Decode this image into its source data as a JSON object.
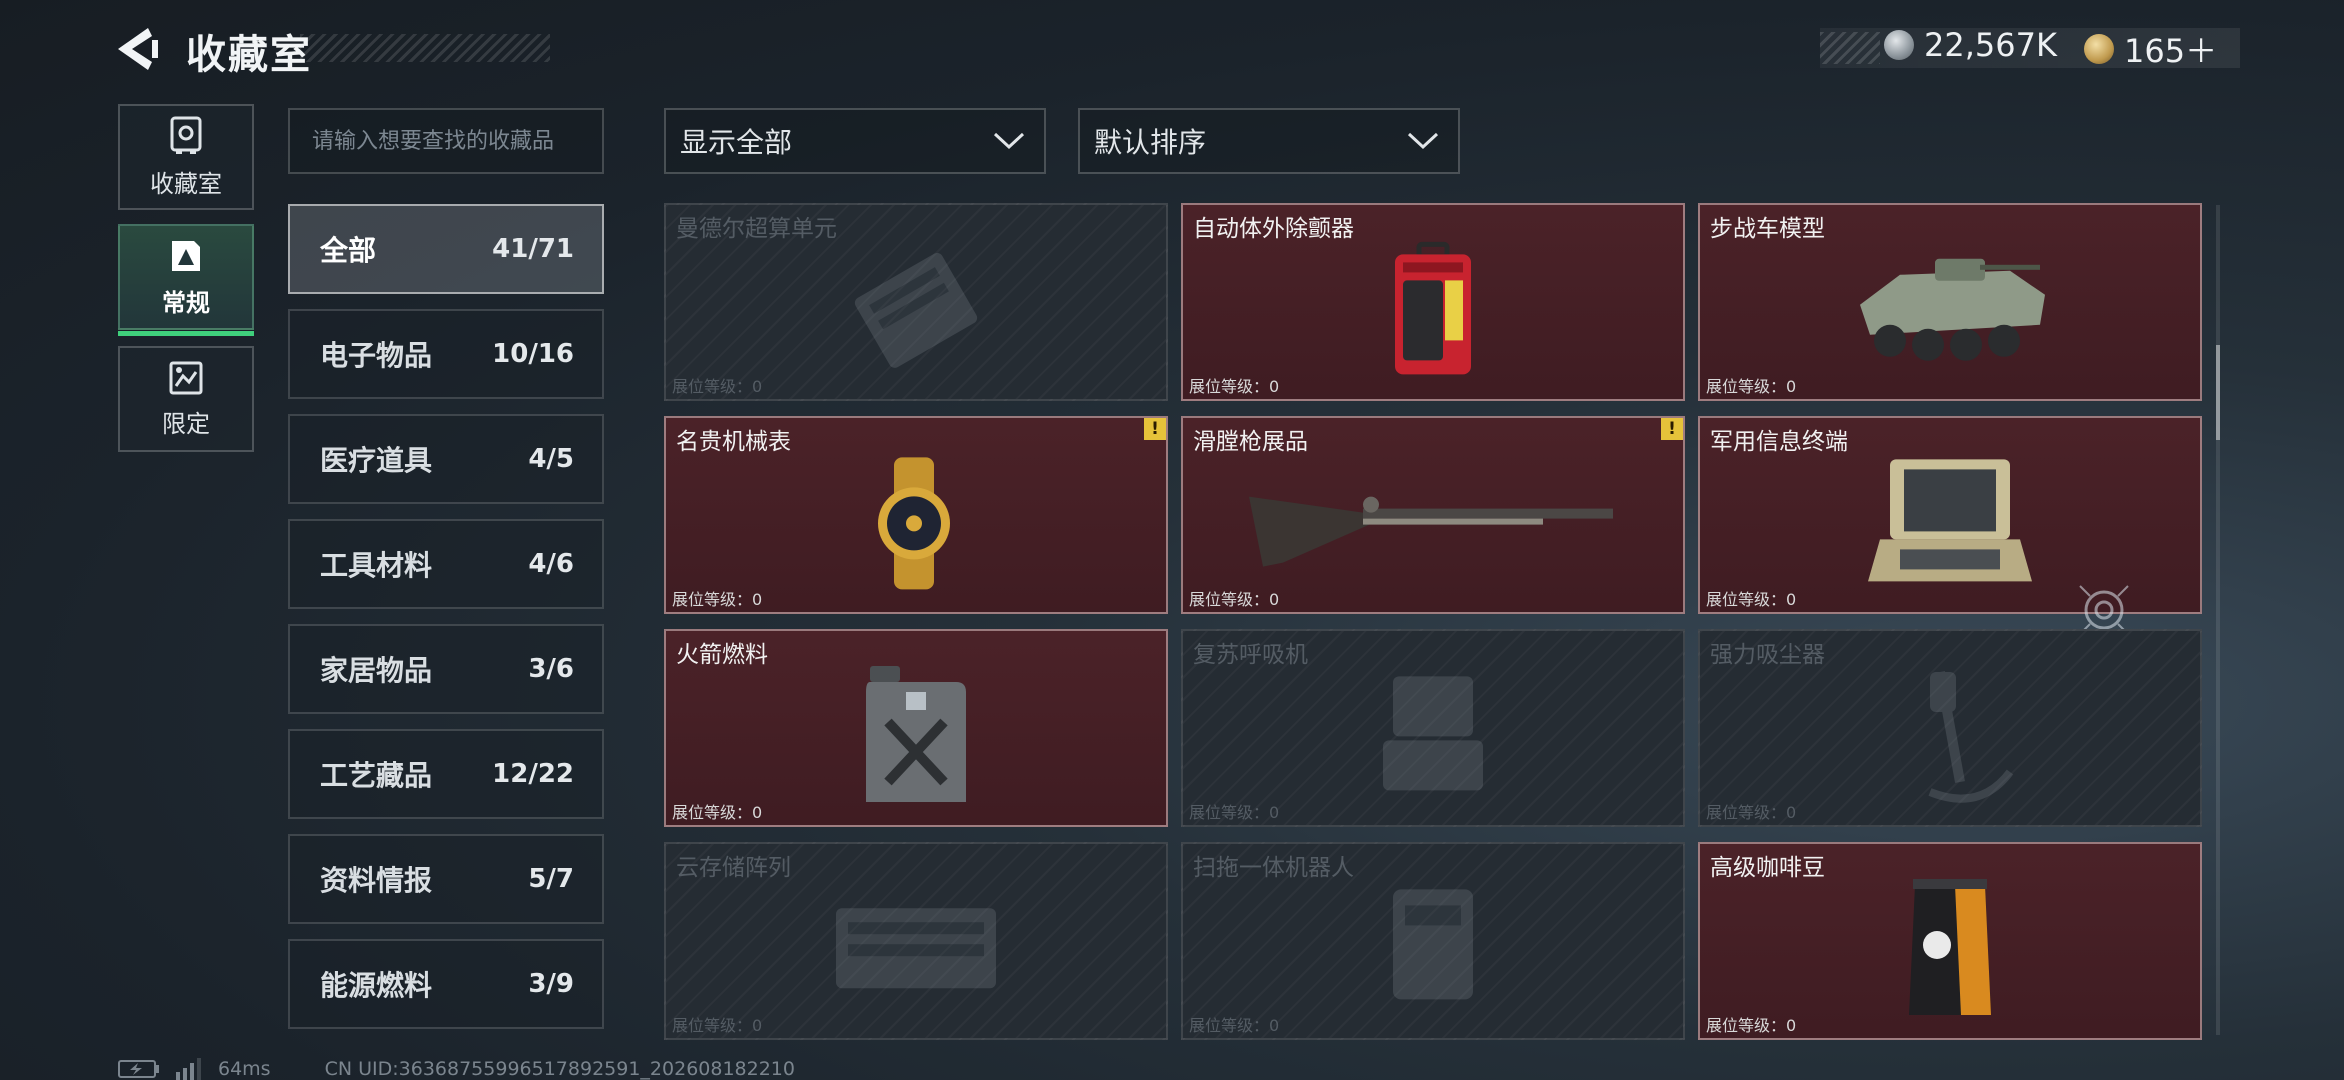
{
  "header": {
    "title": "收藏室",
    "currency": [
      {
        "icon": "silver-coin-icon",
        "value": "22,567K"
      },
      {
        "icon": "gold-medal-icon",
        "value": "165＋"
      }
    ]
  },
  "rail": [
    {
      "label": "收藏室",
      "icon": "safe-icon",
      "active": false
    },
    {
      "label": "常规",
      "icon": "regular-collection-icon",
      "active": true
    },
    {
      "label": "限定",
      "icon": "limited-collection-icon",
      "active": false
    }
  ],
  "search": {
    "placeholder": "请输入想要查找的收藏品"
  },
  "categories": [
    {
      "name": "全部",
      "count": "41/71",
      "active": true
    },
    {
      "name": "电子物品",
      "count": "10/16"
    },
    {
      "name": "医疗道具",
      "count": "4/5"
    },
    {
      "name": "工具材料",
      "count": "4/6"
    },
    {
      "name": "家居物品",
      "count": "3/6"
    },
    {
      "name": "工艺藏品",
      "count": "12/22"
    },
    {
      "name": "资料情报",
      "count": "5/7"
    },
    {
      "name": "能源燃料",
      "count": "3/9"
    }
  ],
  "filters": {
    "display": "显示全部",
    "sort": "默认排序"
  },
  "items": [
    {
      "name": "曼德尔超算单元",
      "level": "展位等级：0",
      "owned": false,
      "icon": "supercomputer-unit-icon"
    },
    {
      "name": "自动体外除颤器",
      "level": "展位等级：0",
      "owned": true,
      "icon": "defibrillator-icon"
    },
    {
      "name": "步战车模型",
      "level": "展位等级：0",
      "owned": true,
      "icon": "ifv-model-icon"
    },
    {
      "name": "名贵机械表",
      "level": "展位等级：0",
      "owned": true,
      "icon": "mechanical-watch-icon",
      "alert": "!"
    },
    {
      "name": "滑膛枪展品",
      "level": "展位等级：0",
      "owned": true,
      "icon": "musket-icon",
      "alert": "!"
    },
    {
      "name": "军用信息终端",
      "level": "展位等级：0",
      "owned": true,
      "icon": "military-terminal-icon"
    },
    {
      "name": "火箭燃料",
      "level": "展位等级：0",
      "owned": true,
      "icon": "fuel-canister-icon"
    },
    {
      "name": "复苏呼吸机",
      "level": "展位等级：0",
      "owned": false,
      "icon": "ventilator-icon"
    },
    {
      "name": "强力吸尘器",
      "level": "展位等级：0",
      "owned": false,
      "icon": "vacuum-cleaner-icon"
    },
    {
      "name": "云存储阵列",
      "level": "展位等级：0",
      "owned": false,
      "icon": "storage-array-icon"
    },
    {
      "name": "扫拖一体机器人",
      "level": "展位等级：0",
      "owned": false,
      "icon": "cleaning-robot-icon"
    },
    {
      "name": "高级咖啡豆",
      "level": "展位等级：0",
      "owned": true,
      "icon": "coffee-bag-icon"
    }
  ],
  "footer": {
    "ping": "64ms",
    "uid": "CN UID:363687559965178925​91_202608182210"
  }
}
